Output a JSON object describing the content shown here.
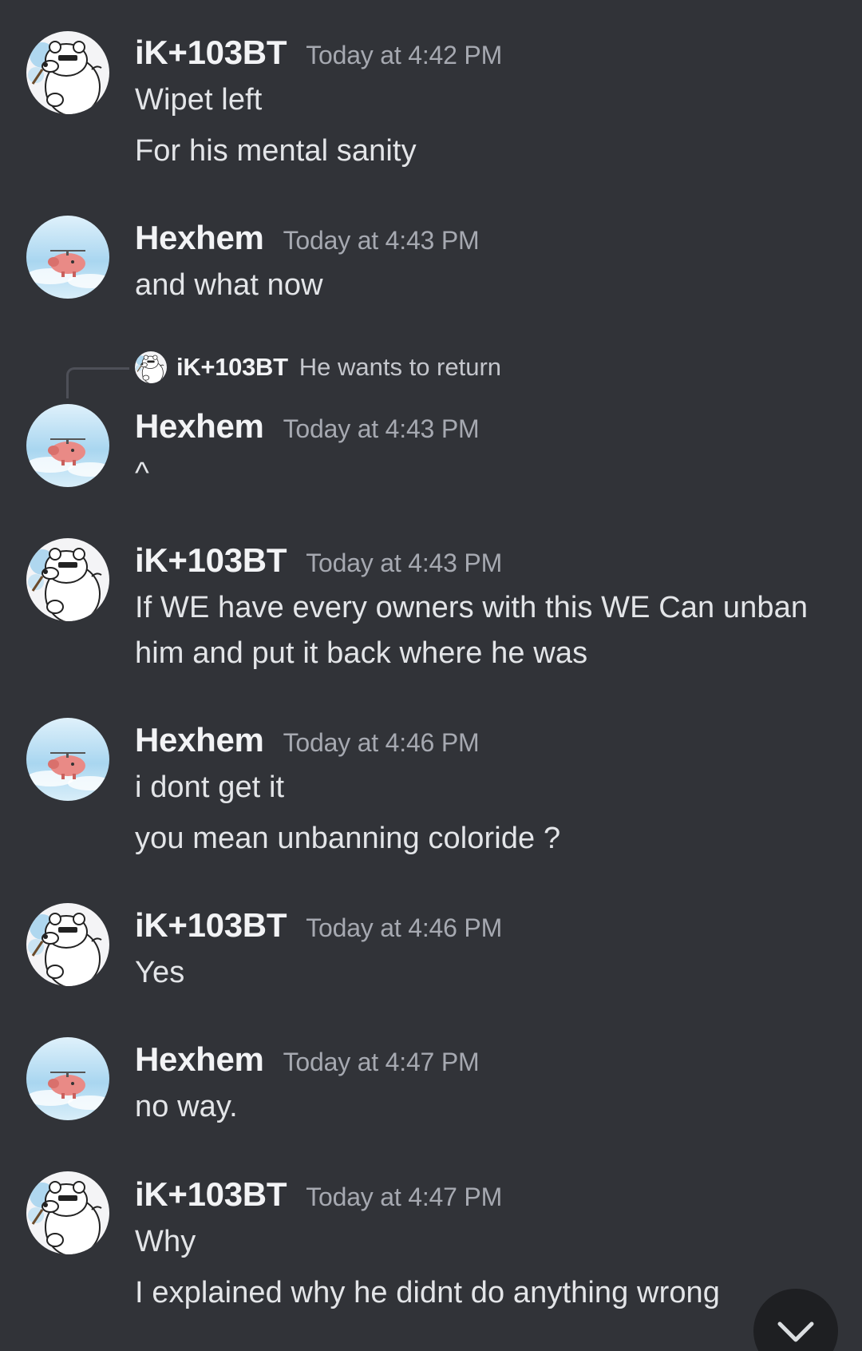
{
  "messages": [
    {
      "author": "iK+103BT",
      "timestamp": "Today at 4:42 PM",
      "avatar": "polar-bear-avatar",
      "lines": [
        "Wipet left",
        "For his mental sanity"
      ]
    },
    {
      "author": "Hexhem",
      "timestamp": "Today at 4:43 PM",
      "avatar": "flying-pig-avatar",
      "lines": [
        "and what now"
      ]
    },
    {
      "author": "Hexhem",
      "timestamp": "Today at 4:43 PM",
      "avatar": "flying-pig-avatar",
      "reply_to": {
        "author": "iK+103BT",
        "text": "He wants to return"
      },
      "lines": [
        "^"
      ]
    },
    {
      "author": "iK+103BT",
      "timestamp": "Today at 4:43 PM",
      "avatar": "polar-bear-avatar",
      "lines": [
        "If WE have every owners with this WE Can unban",
        "him and put it back where he was"
      ]
    },
    {
      "author": "Hexhem",
      "timestamp": "Today at 4:46 PM",
      "avatar": "flying-pig-avatar",
      "lines": [
        "i dont get it",
        "you mean unbanning coloride ?"
      ]
    },
    {
      "author": "iK+103BT",
      "timestamp": "Today at 4:46 PM",
      "avatar": "polar-bear-avatar",
      "lines": [
        "Yes"
      ]
    },
    {
      "author": "Hexhem",
      "timestamp": "Today at 4:47 PM",
      "avatar": "flying-pig-avatar",
      "lines": [
        "no way."
      ]
    },
    {
      "author": "iK+103BT",
      "timestamp": "Today at 4:47 PM",
      "avatar": "polar-bear-avatar",
      "lines": [
        "Why",
        "I explained why he didnt do anything wrong"
      ]
    }
  ],
  "jump_button": {
    "icon": "chevron-down-icon"
  },
  "colors": {
    "background": "#313338",
    "author": "#f2f3f5",
    "timestamp": "#a6a9b1",
    "message_text": "#e3e5e8",
    "jump_button": "#1e1f22"
  }
}
